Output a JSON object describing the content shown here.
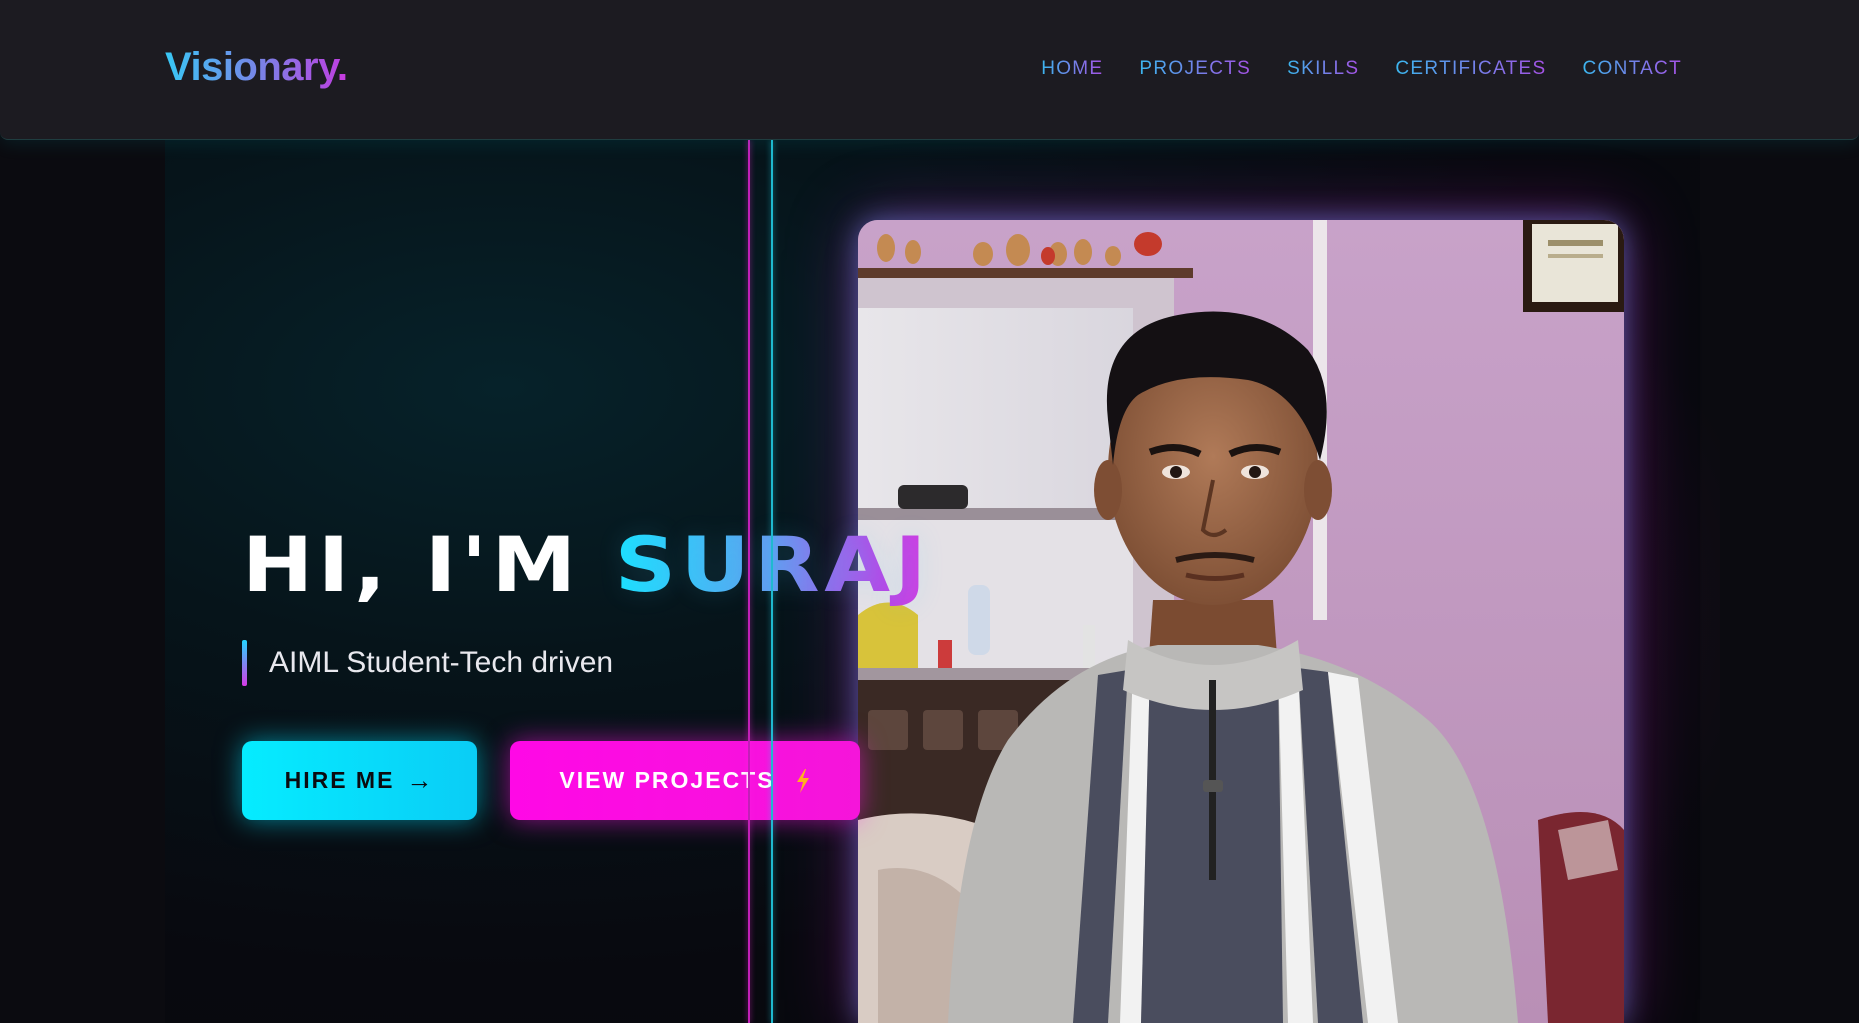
{
  "header": {
    "logo_text": "Visionary",
    "logo_dot": ".",
    "nav": [
      "HOME",
      "PROJECTS",
      "SKILLS",
      "CERTIFICATES",
      "CONTACT"
    ]
  },
  "hero": {
    "greeting": "HI, I'M ",
    "name": "SURAJ",
    "subtitle": "AIML Student-Tech driven",
    "buttons": {
      "hire_label": "HIRE ME",
      "hire_icon": "→",
      "projects_label": "VIEW PROJECTS",
      "projects_icon": "lightning-bolt-icon"
    },
    "portrait_icon": "profile-photo"
  },
  "colors": {
    "accent_cyan": "#05ecff",
    "accent_magenta": "#ff08e6",
    "header_bg": "#1c1b21",
    "page_bg": "#0b0b10"
  }
}
